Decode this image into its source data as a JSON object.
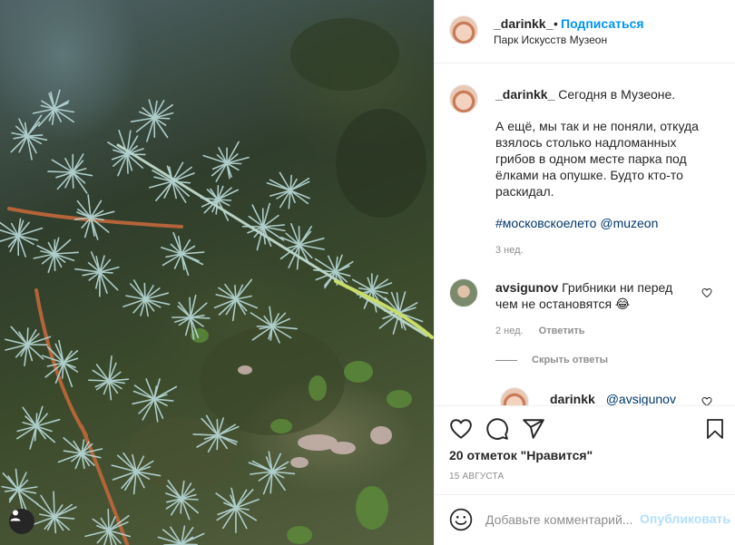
{
  "post": {
    "author": "_darinkk_",
    "follow_label": "Подписаться",
    "separator": "•",
    "location": "Парк Искусств Музеон"
  },
  "caption": {
    "username": "_darinkk_",
    "line1": "Сегодня в Музеоне.",
    "body_lines": [
      "А ещё, мы так и не поняли, откуда",
      "взялось столько надломанных",
      "грибов в одном месте парка под",
      "ёлками на опушке. Будто кто-то",
      "раскидал."
    ],
    "hashtags": [
      "#московскоелето",
      "@muzeon"
    ],
    "time": "3 нед."
  },
  "comment": {
    "username": "avsigunov",
    "line1": "Грибники ни перед",
    "line2": "чем не остановятся 😂",
    "time": "2 нед.",
    "reply_label": "Ответить",
    "hide_replies_label": "Скрыть ответы"
  },
  "reply": {
    "username": "darinkk",
    "mention": "@avsigunov"
  },
  "actions": {
    "likes_text": "20 отметок \"Нравится\"",
    "date": "15 АВГУСТА"
  },
  "add_comment": {
    "placeholder": "Добавьте комментарий...",
    "publish_label": "Опубликовать"
  },
  "icons": [
    "heart-icon",
    "comment-icon",
    "share-icon",
    "bookmark-icon",
    "emoji-icon",
    "user-tag-icon"
  ]
}
